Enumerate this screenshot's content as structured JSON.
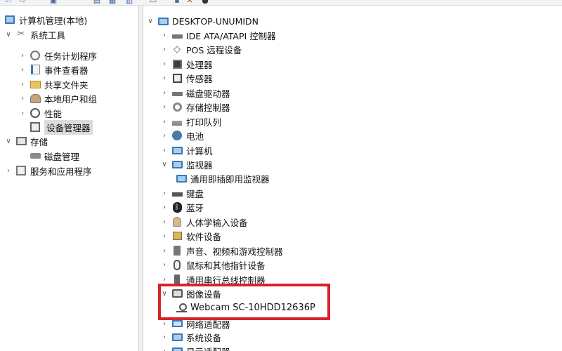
{
  "toolbar": {
    "icons": [
      "back-arrow-icon",
      "forward-arrow-icon",
      "up-icon",
      "properties-icon",
      "help-icon",
      "computer-icon",
      "scan-icon",
      "delete-icon",
      "enable-icon"
    ]
  },
  "left_tree": {
    "root": "计算机管理(本地)",
    "items": [
      {
        "label": "系统工具",
        "expanded": true
      },
      {
        "label": "任务计划程序"
      },
      {
        "label": "事件查看器"
      },
      {
        "label": "共享文件夹"
      },
      {
        "label": "本地用户和组"
      },
      {
        "label": "性能"
      },
      {
        "label": "设备管理器",
        "selected": true
      },
      {
        "label": "存储",
        "expanded": true
      },
      {
        "label": "磁盘管理"
      },
      {
        "label": "服务和应用程序"
      }
    ]
  },
  "device_tree": {
    "root": "DESKTOP-UNUMIDN",
    "categories": [
      {
        "label": "IDE ATA/ATAPI 控制器",
        "icon": "ide-controller-icon"
      },
      {
        "label": "POS 远程设备",
        "icon": "pos-device-icon"
      },
      {
        "label": "处理器",
        "icon": "processor-icon"
      },
      {
        "label": "传感器",
        "icon": "sensor-icon"
      },
      {
        "label": "磁盘驱动器",
        "icon": "disk-drive-icon"
      },
      {
        "label": "存储控制器",
        "icon": "storage-controller-icon"
      },
      {
        "label": "打印队列",
        "icon": "printer-icon"
      },
      {
        "label": "电池",
        "icon": "battery-icon"
      },
      {
        "label": "计算机",
        "icon": "computer-icon"
      },
      {
        "label": "监视器",
        "icon": "monitor-icon",
        "expanded": true
      },
      {
        "label": "通用即插即用监视器",
        "icon": "monitor-icon",
        "child": true
      },
      {
        "label": "键盘",
        "icon": "keyboard-icon"
      },
      {
        "label": "蓝牙",
        "icon": "bluetooth-icon"
      },
      {
        "label": "人体学输入设备",
        "icon": "hid-icon"
      },
      {
        "label": "软件设备",
        "icon": "software-device-icon"
      },
      {
        "label": "声音、视频和游戏控制器",
        "icon": "speaker-icon"
      },
      {
        "label": "鼠标和其他指针设备",
        "icon": "mouse-icon"
      },
      {
        "label": "通用串行总线控制器",
        "icon": "usb-icon"
      },
      {
        "label": "图像设备",
        "icon": "camera-icon",
        "expanded": true
      },
      {
        "label": "Webcam SC-10HDD12636P",
        "icon": "webcam-icon",
        "child": true
      },
      {
        "label": "网络适配器",
        "icon": "network-adapter-icon"
      },
      {
        "label": "系统设备",
        "icon": "system-device-icon"
      },
      {
        "label": "显示适配器",
        "icon": "display-adapter-icon"
      }
    ]
  },
  "highlight_color": "#d7232a",
  "accent_color": "#3a78b8"
}
